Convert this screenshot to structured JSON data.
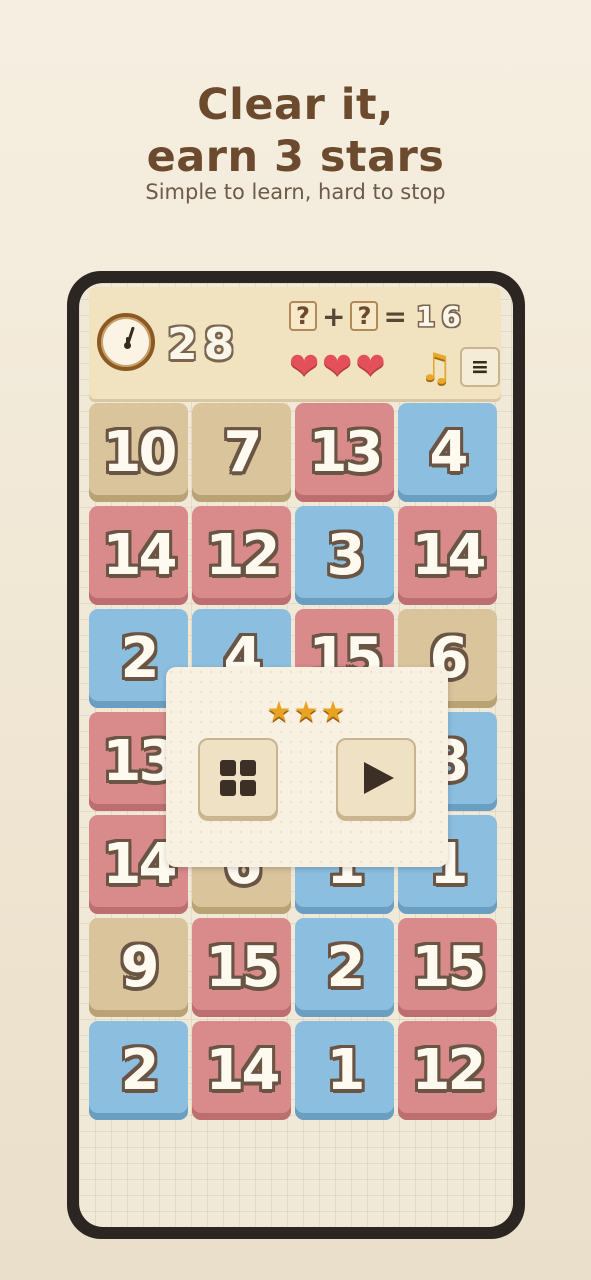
{
  "promo": {
    "headline_line1": "Clear it,",
    "headline_line2": "earn 3 stars",
    "subheadline": "Simple to learn, hard to stop"
  },
  "hud": {
    "timer": "28",
    "equation": {
      "operand1": "?",
      "operator": "+",
      "operand2": "?",
      "equals": "=",
      "target": "16"
    },
    "lives": 3,
    "heart_glyph": "❤",
    "music_glyph": "♫",
    "menu_glyph": "≡"
  },
  "board": {
    "rows": [
      [
        {
          "value": "10",
          "color": "tan"
        },
        {
          "value": "7",
          "color": "tan"
        },
        {
          "value": "13",
          "color": "red"
        },
        {
          "value": "4",
          "color": "blue"
        }
      ],
      [
        {
          "value": "14",
          "color": "red"
        },
        {
          "value": "12",
          "color": "red"
        },
        {
          "value": "3",
          "color": "blue"
        },
        {
          "value": "14",
          "color": "red"
        }
      ],
      [
        {
          "value": "2",
          "color": "blue"
        },
        {
          "value": "4",
          "color": "blue"
        },
        {
          "value": "15",
          "color": "red"
        },
        {
          "value": "6",
          "color": "tan"
        }
      ],
      [
        {
          "value": "13",
          "color": "red"
        },
        {
          "value": "",
          "color": "tan"
        },
        {
          "value": "",
          "color": "blue"
        },
        {
          "value": "8",
          "color": "blue"
        }
      ],
      [
        {
          "value": "14",
          "color": "red"
        },
        {
          "value": "6",
          "color": "tan"
        },
        {
          "value": "1",
          "color": "blue"
        },
        {
          "value": "1",
          "color": "blue"
        }
      ],
      [
        {
          "value": "9",
          "color": "tan"
        },
        {
          "value": "15",
          "color": "red"
        },
        {
          "value": "2",
          "color": "blue"
        },
        {
          "value": "15",
          "color": "red"
        }
      ],
      [
        {
          "value": "2",
          "color": "blue"
        },
        {
          "value": "14",
          "color": "red"
        },
        {
          "value": "1",
          "color": "blue"
        },
        {
          "value": "12",
          "color": "red"
        }
      ]
    ]
  },
  "result_popup": {
    "stars_earned": 3,
    "stars_text": "★★★",
    "levels_icon": "grid-icon",
    "play_icon": "play-icon"
  }
}
